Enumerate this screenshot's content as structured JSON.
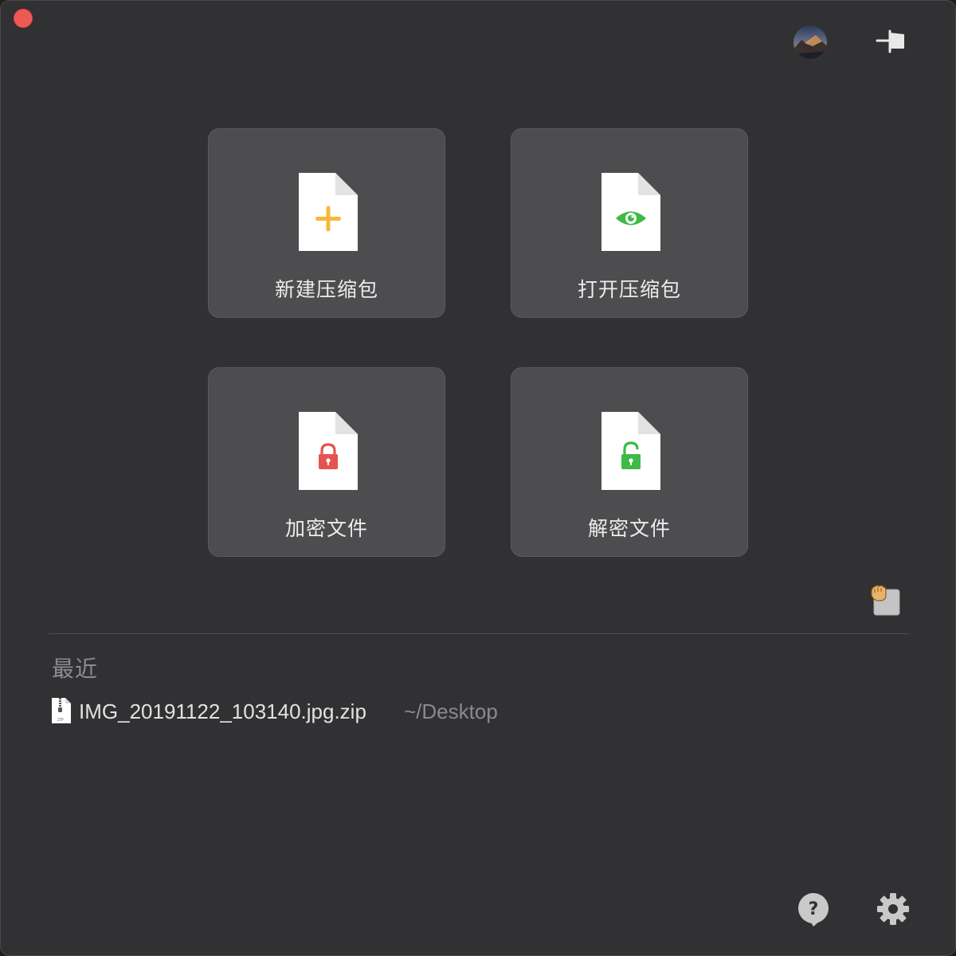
{
  "window": {
    "close_color": "#ed5a56"
  },
  "toolbar": {
    "avatar_icon": "wallpaper-avatar-icon",
    "pin_icon": "pin-icon"
  },
  "actions": [
    {
      "label": "新建压缩包",
      "icon": "plus-icon",
      "accent": "#f4b93a"
    },
    {
      "label": "打开压缩包",
      "icon": "eye-icon",
      "accent": "#3dbb45"
    },
    {
      "label": "加密文件",
      "icon": "lock-closed-icon",
      "accent": "#e5544e"
    },
    {
      "label": "解密文件",
      "icon": "lock-open-icon",
      "accent": "#3dbb45"
    }
  ],
  "recent": {
    "title": "最近",
    "items": [
      {
        "name": "IMG_20191122_103140.jpg.zip",
        "path": "~/Desktop",
        "icon": "zip-file-icon"
      }
    ]
  },
  "footer": {
    "help_icon": "help-bubble-icon",
    "settings_icon": "gear-icon"
  }
}
